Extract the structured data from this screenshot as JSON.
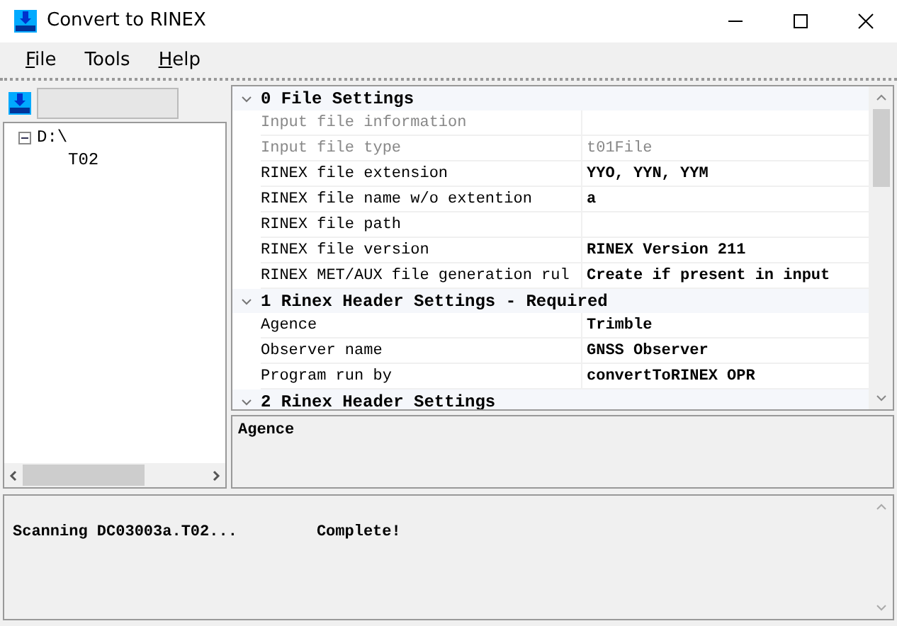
{
  "window": {
    "title": "Convert to RINEX"
  },
  "menu": [
    {
      "label": "File",
      "underlined": true
    },
    {
      "label": "Tools",
      "underlined": false
    },
    {
      "label": "Help",
      "underlined": true
    }
  ],
  "tree": [
    {
      "label": "D:\\",
      "expanded": true,
      "children": [
        {
          "label": "T02"
        }
      ]
    }
  ],
  "properties": [
    {
      "title": "0 File Settings",
      "expanded": true,
      "rows": [
        {
          "name": "Input file information",
          "value": "",
          "disabled": true
        },
        {
          "name": "Input file type",
          "value": "t01File",
          "disabled": true
        },
        {
          "name": "RINEX file extension",
          "value": "YYO, YYN, YYM",
          "disabled": false
        },
        {
          "name": "RINEX file name w/o extention",
          "value": "a",
          "disabled": false
        },
        {
          "name": "RINEX file path",
          "value": "",
          "disabled": false
        },
        {
          "name": "RINEX file version",
          "value": "RINEX Version 211",
          "disabled": false
        },
        {
          "name": "RINEX MET/AUX file generation rul",
          "value": "Create if present in input",
          "disabled": false
        }
      ]
    },
    {
      "title": "1 Rinex Header Settings - Required",
      "expanded": true,
      "rows": [
        {
          "name": "Agence",
          "value": "Trimble",
          "disabled": false
        },
        {
          "name": "Observer name",
          "value": "GNSS Observer",
          "disabled": false
        },
        {
          "name": "Program run by",
          "value": "convertToRINEX OPR",
          "disabled": false
        }
      ]
    },
    {
      "title": "2 Rinex Header Settings",
      "expanded": true
    }
  ],
  "description": "Agence",
  "log": [
    {
      "text": "Scanning DC03003a.T02...",
      "status": "Complete!"
    }
  ]
}
